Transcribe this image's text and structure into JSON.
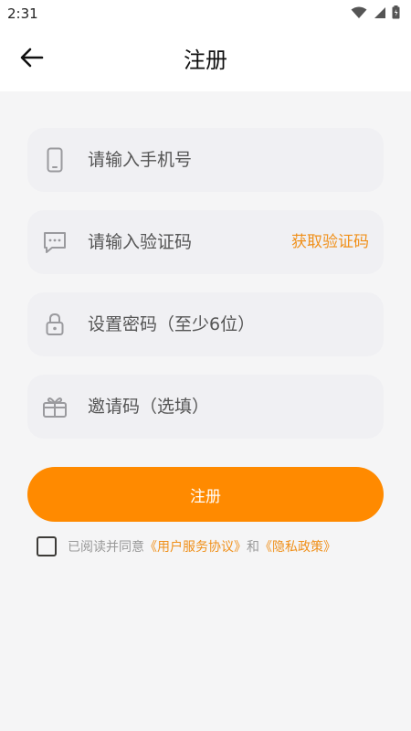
{
  "status_bar": {
    "time": "2:31",
    "icons": [
      "wifi-icon",
      "signal-icon",
      "battery-icon"
    ]
  },
  "header": {
    "title": "注册",
    "back_icon": "back-arrow-icon"
  },
  "form": {
    "phone": {
      "placeholder": "请输入手机号",
      "value": "",
      "icon": "phone-icon"
    },
    "code": {
      "placeholder": "请输入验证码",
      "value": "",
      "icon": "message-icon",
      "get_code_label": "获取验证码"
    },
    "password": {
      "placeholder": "设置密码（至少6位）",
      "value": "",
      "icon": "lock-icon"
    },
    "invite": {
      "placeholder": "邀请码（选填）",
      "value": "",
      "icon": "gift-icon"
    }
  },
  "register_button": {
    "label": "注册"
  },
  "agreement": {
    "checked": false,
    "prefix": "已阅读并同意",
    "terms_link": "《用户服务协议》",
    "and": "和",
    "privacy_link": "《隐私政策》"
  },
  "colors": {
    "accent": "#ff8a00",
    "link": "#f0901a",
    "field_bg": "#f0f0f3",
    "page_bg": "#f5f5f6"
  }
}
